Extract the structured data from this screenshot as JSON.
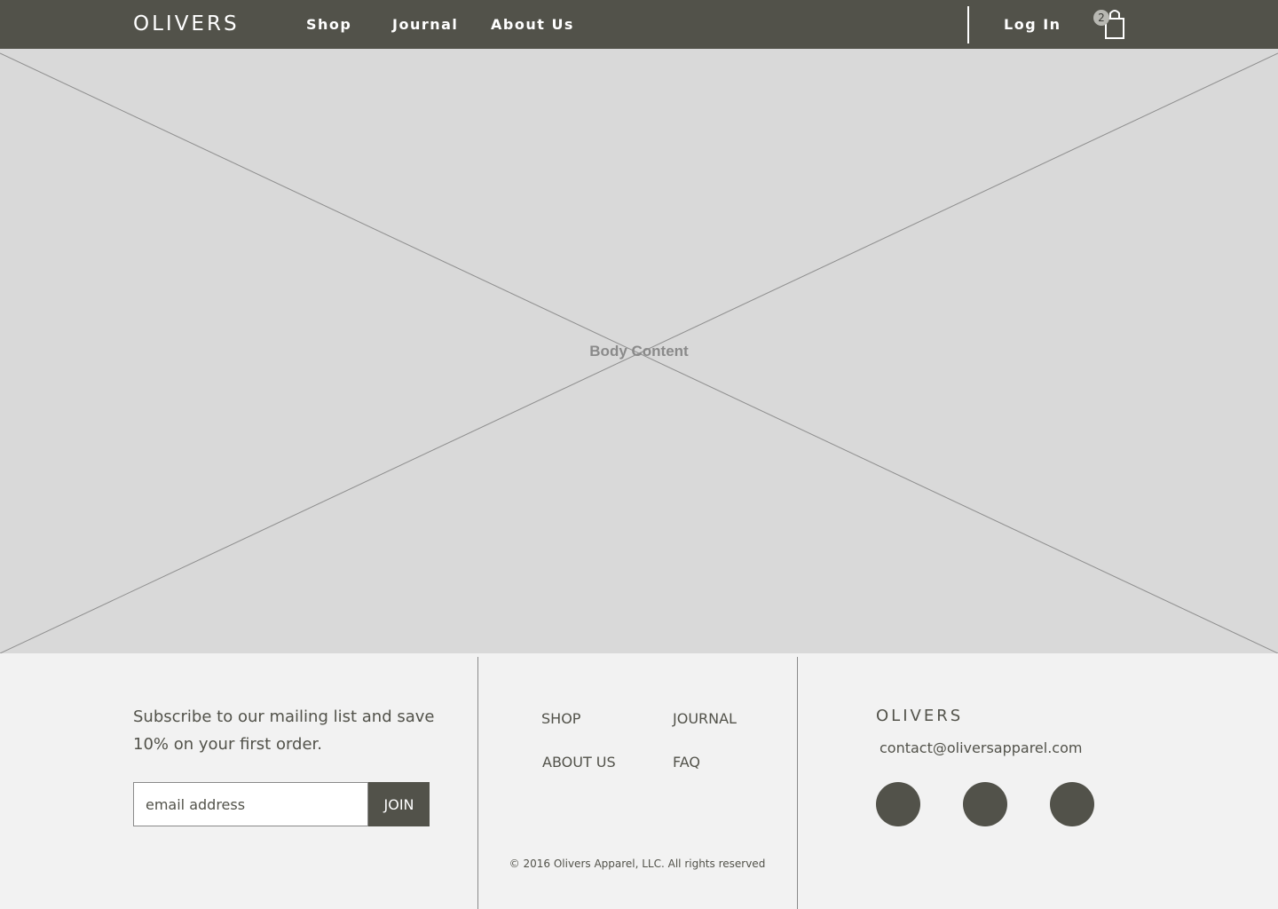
{
  "header": {
    "logo": "OLIVERS",
    "nav": {
      "shop": "Shop",
      "journal": "Journal",
      "about": "About Us"
    },
    "login": "Log In",
    "cart_count": "2",
    "background_color": "#52524a"
  },
  "main": {
    "placeholder_label": "Body Content",
    "background_color": "#d9d9d9"
  },
  "footer": {
    "subscribe_text": "Subscribe to our mailing list and save 10% on your first order.",
    "email_placeholder": "email address",
    "join_label": "JOIN",
    "links": {
      "shop": "SHOP",
      "journal": "JOURNAL",
      "about": "ABOUT US",
      "faq": "FAQ"
    },
    "copyright": "© 2016 Olivers Apparel, LLC. All rights reserved",
    "logo": "OLIVERS",
    "contact_email": "contact@oliversapparel.com",
    "social_icons": [
      "social-icon",
      "social-icon",
      "social-icon"
    ]
  }
}
